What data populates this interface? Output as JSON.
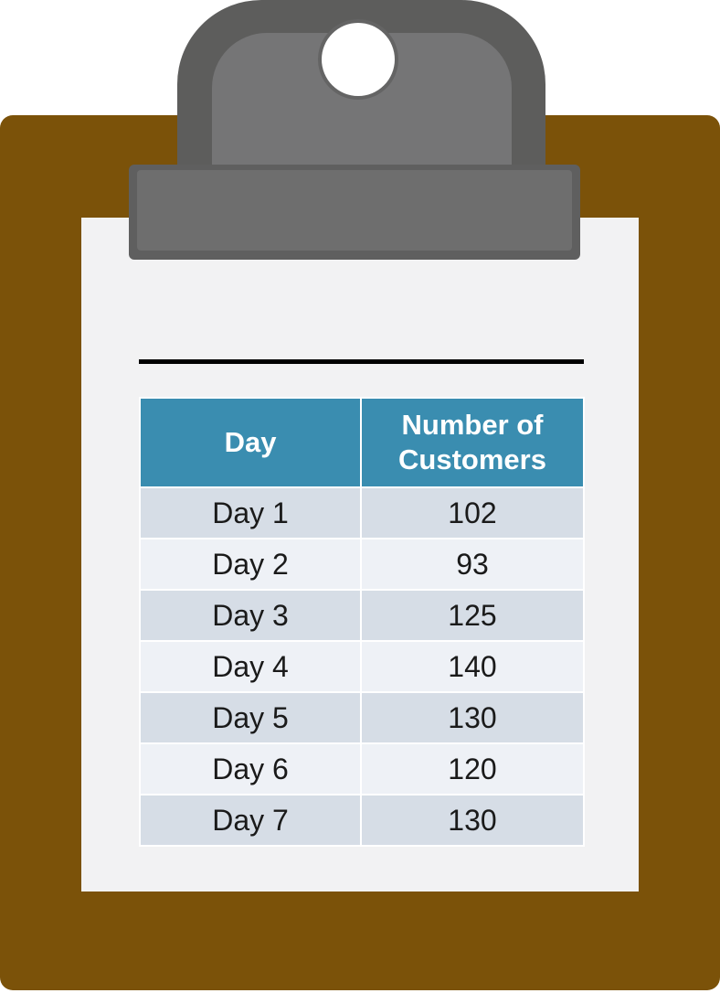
{
  "table": {
    "headers": [
      "Day",
      "Number of\nCustomers"
    ],
    "rows": [
      {
        "day": "Day 1",
        "customers": "102"
      },
      {
        "day": "Day 2",
        "customers": "93"
      },
      {
        "day": "Day 3",
        "customers": "125"
      },
      {
        "day": "Day 4",
        "customers": "140"
      },
      {
        "day": "Day 5",
        "customers": "130"
      },
      {
        "day": "Day 6",
        "customers": "120"
      },
      {
        "day": "Day 7",
        "customers": "130"
      }
    ]
  },
  "colors": {
    "board": "#7b5209",
    "paper": "#f2f2f3",
    "clip_dark": "#5d5d5c",
    "clip_light": "#757576",
    "header_bg": "#3a8db0",
    "row_odd": "#d6dde6",
    "row_even": "#eef1f6"
  },
  "icons": {
    "clip": "clipboard-clip-icon"
  }
}
